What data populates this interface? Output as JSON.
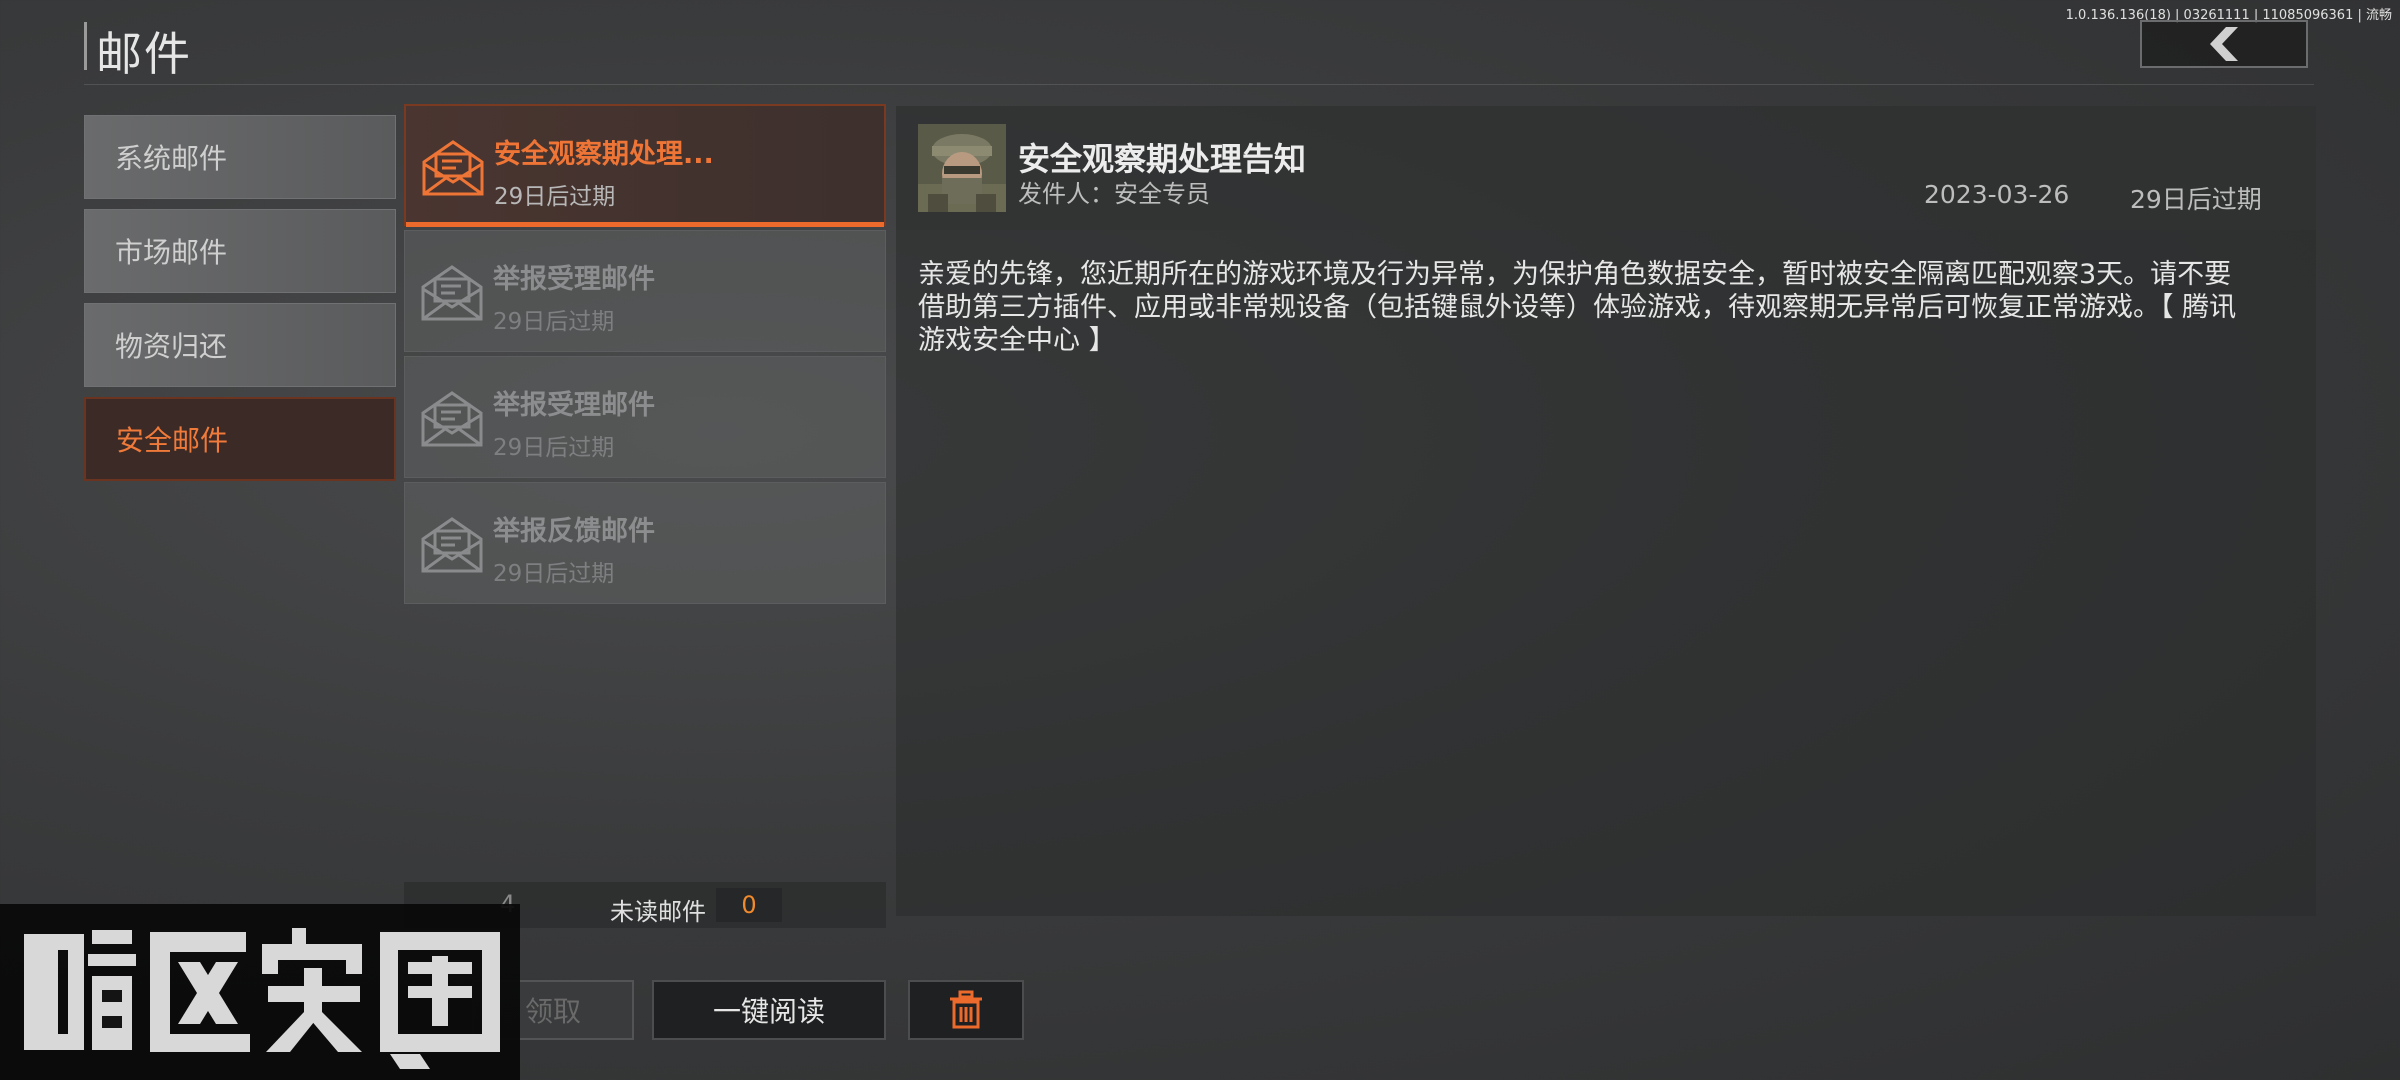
{
  "header": {
    "title": "邮件",
    "version": "1.0.136.136(18) | 03261111 | 11085096361 | 流畅"
  },
  "sidebar": {
    "items": [
      {
        "label": "系统邮件",
        "active": false
      },
      {
        "label": "市场邮件",
        "active": false
      },
      {
        "label": "物资归还",
        "active": false
      },
      {
        "label": "安全邮件",
        "active": true
      }
    ]
  },
  "mail_list": {
    "items": [
      {
        "title": "安全观察期处理...",
        "expiry": "29日后过期",
        "active": true
      },
      {
        "title": "举报受理邮件",
        "expiry": "29日后过期",
        "active": false
      },
      {
        "title": "举报受理邮件",
        "expiry": "29日后过期",
        "active": false
      },
      {
        "title": "举报反馈邮件",
        "expiry": "29日后过期",
        "active": false
      }
    ],
    "footer": {
      "count": "4",
      "unread_label": "未读邮件",
      "unread_count": "0"
    }
  },
  "actions": {
    "claim_label": "领取",
    "read_all_label": "一键阅读",
    "delete_icon": "trash-icon"
  },
  "detail": {
    "title": "安全观察期处理告知",
    "sender": "发件人：安全专员",
    "date": "2023-03-26",
    "expiry": "29日后过期",
    "body": "亲爱的先锋，您近期所在的游戏环境及行为异常，为保护角色数据安全，暂时被安全隔离匹配观察3天。请不要借助第三方插件、应用或非常规设备（包括键鼠外设等）体验游戏，待观察期无异常后可恢复正常游戏。【 腾讯游戏安全中心 】"
  },
  "logo": {
    "text": "暗区突围"
  },
  "colors": {
    "accent": "#ec6a2c",
    "active_text": "#f07a3a"
  }
}
